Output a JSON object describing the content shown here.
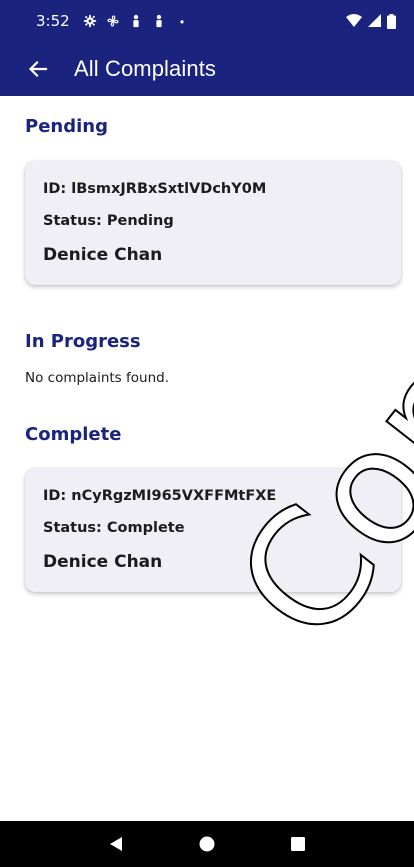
{
  "status_bar": {
    "time": "3:52",
    "icons_left": [
      "settings-icon",
      "fan-icon",
      "person-icon",
      "person-icon",
      "dot-icon"
    ],
    "icons_right": [
      "wifi-icon",
      "signal-icon",
      "battery-icon"
    ]
  },
  "app_bar": {
    "title": "All Complaints",
    "back_icon": "arrow-back-icon"
  },
  "sections": {
    "pending": {
      "heading": "Pending",
      "card": {
        "id_text": "ID: lBsmxJRBxSxtlVDchY0M",
        "status_text": "Status: Pending",
        "name": "Denice Chan"
      }
    },
    "in_progress": {
      "heading": "In Progress",
      "empty_text": "No complaints found."
    },
    "complete": {
      "heading": "Complete",
      "card": {
        "id_text": "ID: nCyRgzMI965VXFFMtFXE",
        "status_text": "Status: Complete",
        "name": "Denice Chan"
      }
    }
  },
  "watermark": "Copyright",
  "nav_bar": {
    "buttons": [
      "back-triangle-icon",
      "home-circle-icon",
      "recents-square-icon"
    ]
  },
  "colors": {
    "primary": "#1a237e",
    "card_bg": "#f1eff6",
    "text": "#1c1c1c",
    "nav_bg": "#000000"
  }
}
